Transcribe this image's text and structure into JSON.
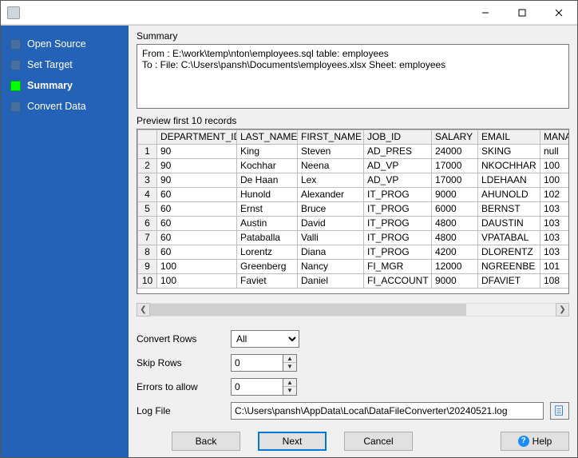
{
  "sidebar": {
    "items": [
      {
        "label": "Open Source"
      },
      {
        "label": "Set Target"
      },
      {
        "label": "Summary"
      },
      {
        "label": "Convert Data"
      }
    ],
    "active_index": 2
  },
  "summary": {
    "heading": "Summary",
    "text": "From : E:\\work\\temp\\nton\\employees.sql table: employees\nTo : File: C:\\Users\\pansh\\Documents\\employees.xlsx Sheet: employees"
  },
  "preview": {
    "heading": "Preview first 10 records",
    "columns": [
      "DEPARTMENT_ID",
      "LAST_NAME",
      "FIRST_NAME",
      "JOB_ID",
      "SALARY",
      "EMAIL",
      "MANAG"
    ],
    "rows": [
      [
        "90",
        "King",
        "Steven",
        "AD_PRES",
        "24000",
        "SKING",
        "null"
      ],
      [
        "90",
        "Kochhar",
        "Neena",
        "AD_VP",
        "17000",
        "NKOCHHAR",
        "100"
      ],
      [
        "90",
        "De Haan",
        "Lex",
        "AD_VP",
        "17000",
        "LDEHAAN",
        "100"
      ],
      [
        "60",
        "Hunold",
        "Alexander",
        "IT_PROG",
        "9000",
        "AHUNOLD",
        "102"
      ],
      [
        "60",
        "Ernst",
        "Bruce",
        "IT_PROG",
        "6000",
        "BERNST",
        "103"
      ],
      [
        "60",
        "Austin",
        "David",
        "IT_PROG",
        "4800",
        "DAUSTIN",
        "103"
      ],
      [
        "60",
        "Pataballa",
        "Valli",
        "IT_PROG",
        "4800",
        "VPATABAL",
        "103"
      ],
      [
        "60",
        "Lorentz",
        "Diana",
        "IT_PROG",
        "4200",
        "DLORENTZ",
        "103"
      ],
      [
        "100",
        "Greenberg",
        "Nancy",
        "FI_MGR",
        "12000",
        "NGREENBE",
        "101"
      ],
      [
        "100",
        "Faviet",
        "Daniel",
        "FI_ACCOUNT",
        "9000",
        "DFAVIET",
        "108"
      ]
    ]
  },
  "form": {
    "convert_rows_label": "Convert Rows",
    "convert_rows_value": "All",
    "skip_rows_label": "Skip Rows",
    "skip_rows_value": "0",
    "errors_label": "Errors to allow",
    "errors_value": "0",
    "log_file_label": "Log File",
    "log_file_value": "C:\\Users\\pansh\\AppData\\Local\\DataFileConverter\\20240521.log"
  },
  "buttons": {
    "back": "Back",
    "next": "Next",
    "cancel": "Cancel",
    "help": "Help"
  }
}
